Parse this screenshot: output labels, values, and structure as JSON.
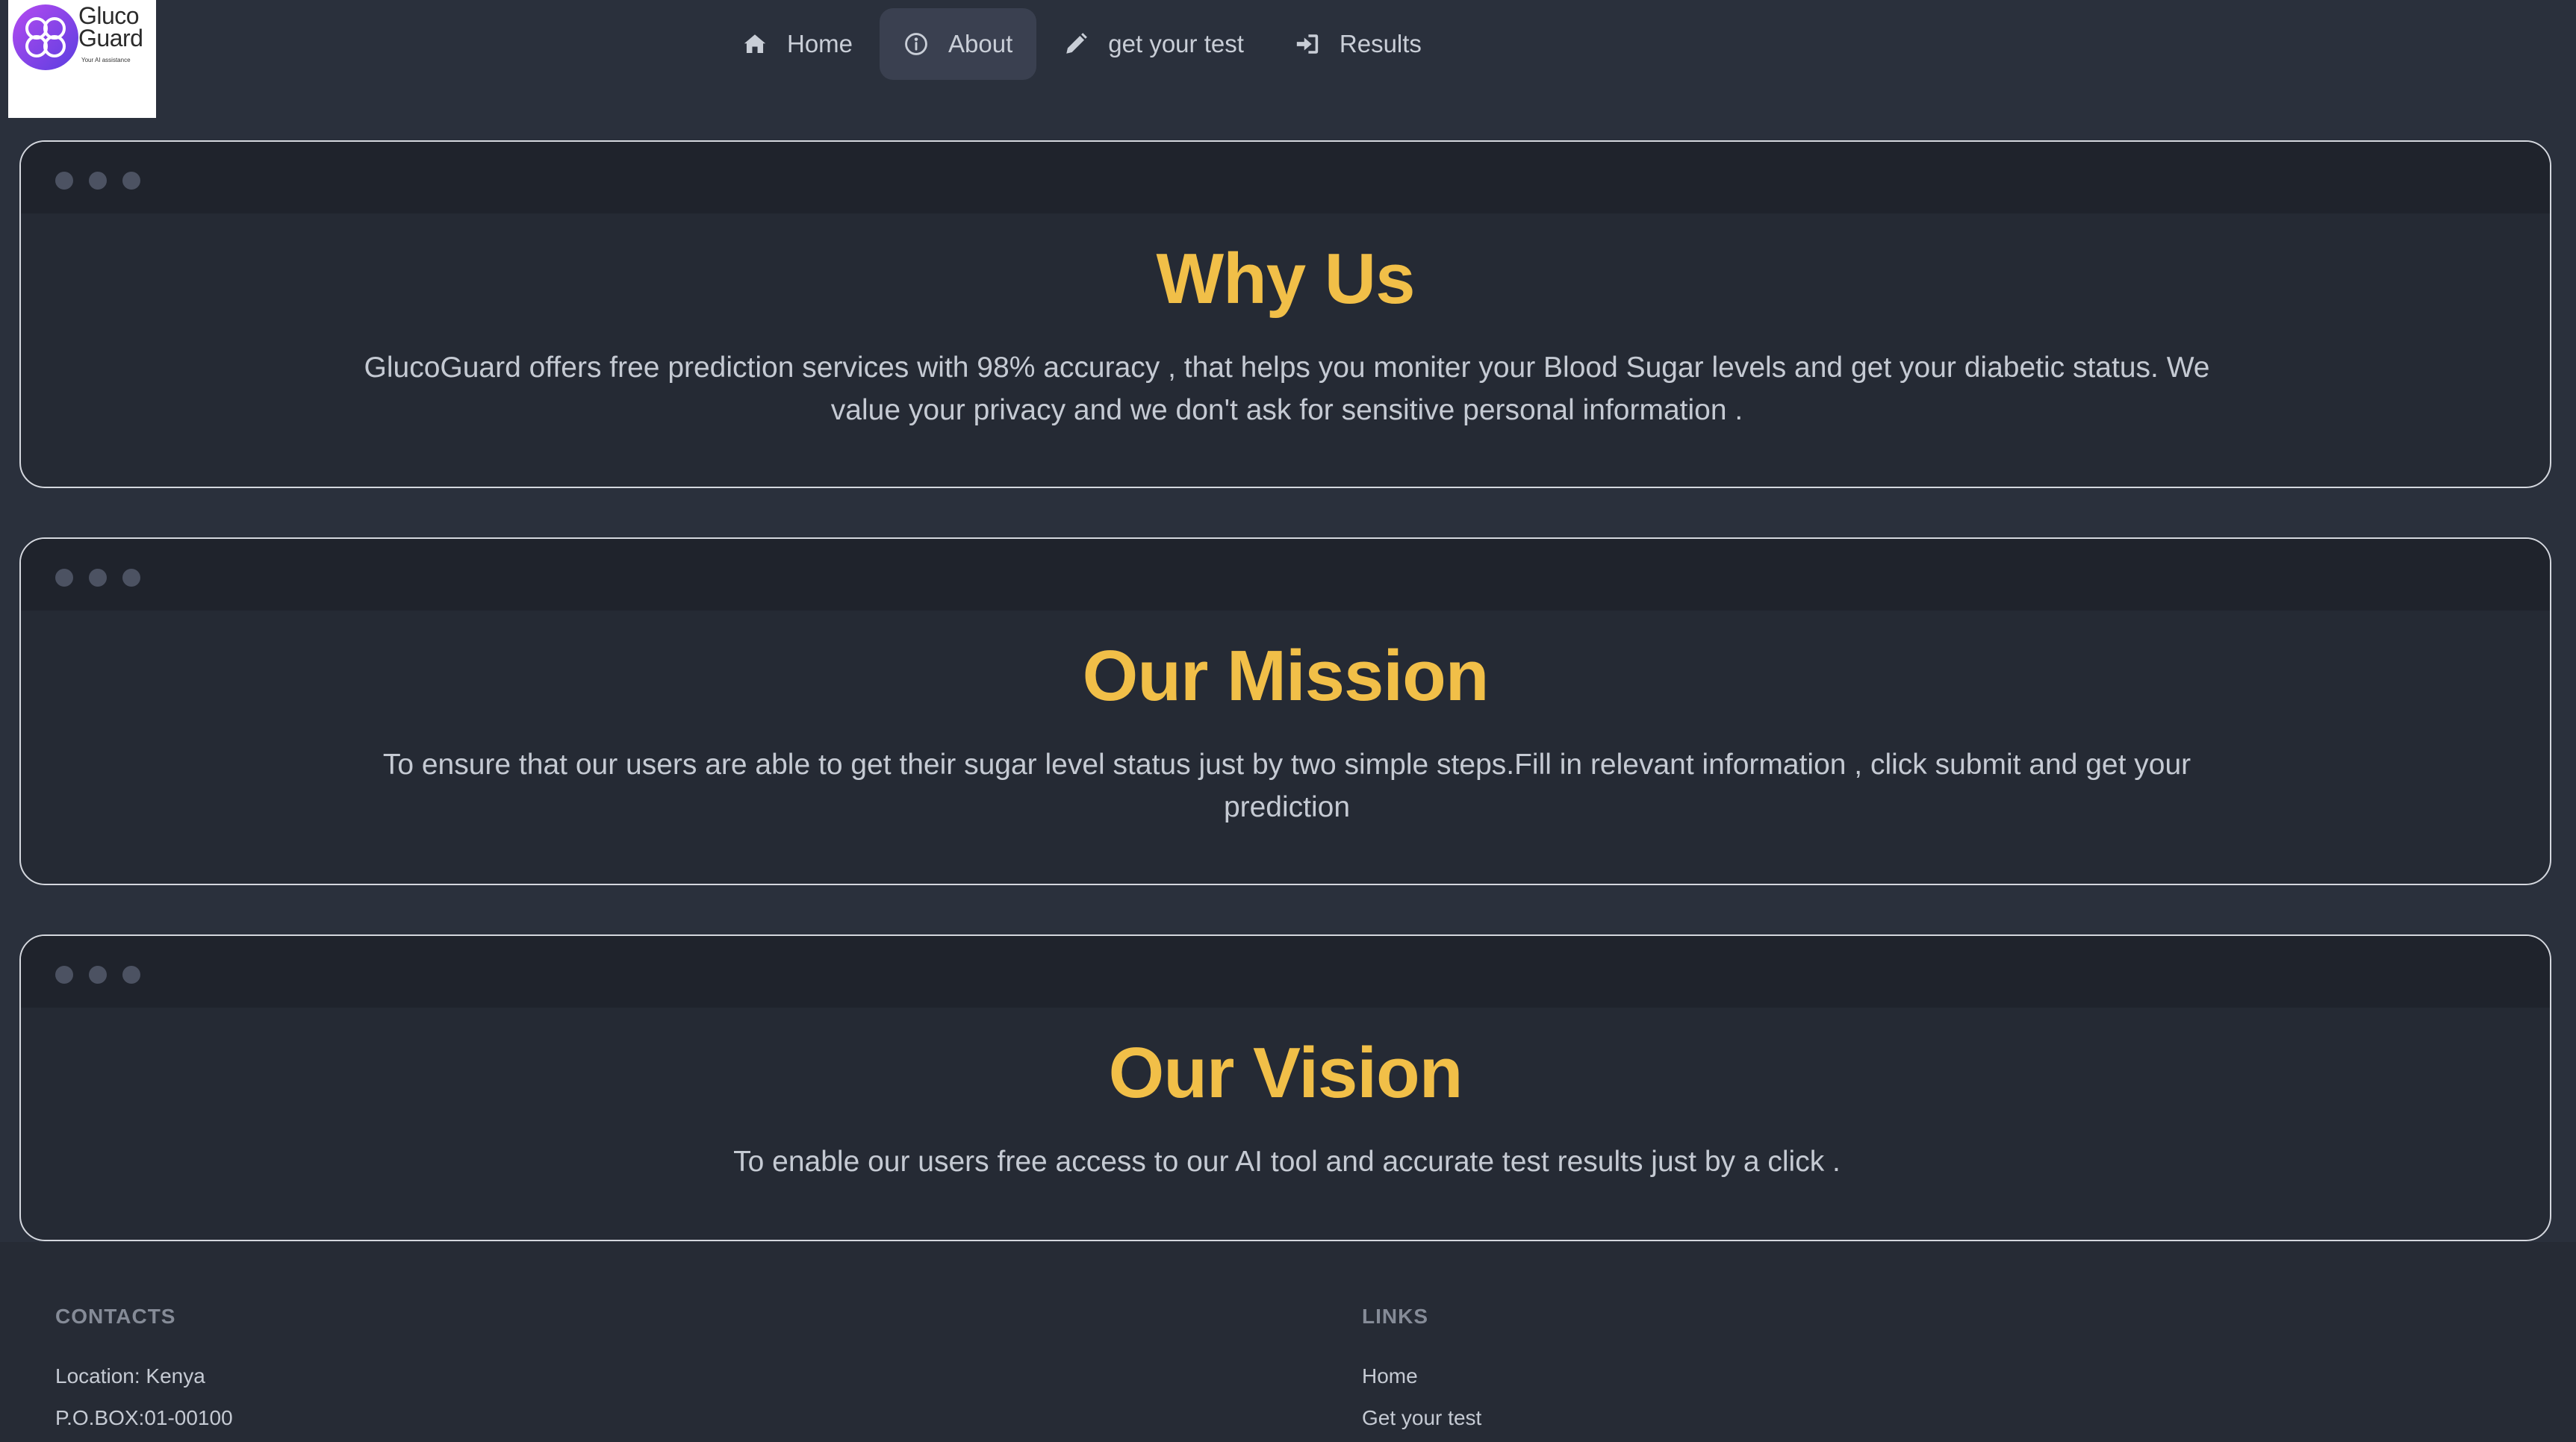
{
  "brand": {
    "name_line1": "Gluco",
    "name_line2": "Guard",
    "tagline": "Your AI assistance"
  },
  "nav": {
    "items": [
      {
        "label": "Home",
        "icon": "home-icon"
      },
      {
        "label": "About",
        "icon": "info-icon",
        "active": true
      },
      {
        "label": "get your test",
        "icon": "pencil-icon"
      },
      {
        "label": "Results",
        "icon": "sign-in-icon"
      }
    ]
  },
  "cards": [
    {
      "title": "Why Us",
      "body": "GlucoGuard offers free prediction services with 98% accuracy , that helps you moniter your Blood Sugar levels and get your diabetic status. We value your privacy and we don't ask for sensitive personal information ."
    },
    {
      "title": "Our Mission",
      "body": "To ensure that our users are able to get their sugar level status just by two simple steps.Fill in relevant information , click submit and get your prediction"
    },
    {
      "title": "Our Vision",
      "body": "To enable our users free access to our AI tool and accurate test results just by a click ."
    }
  ],
  "footer": {
    "contacts_heading": "CONTACTS",
    "location": "Location: Kenya",
    "pobox": "P.O.BOX:01-00100",
    "links_heading": "LINKS",
    "links": [
      "Home",
      "Get your test"
    ]
  },
  "colors": {
    "background": "#2a303c",
    "card": "#252a34",
    "accent": "#f1bf48",
    "text": "#c5cad3"
  }
}
